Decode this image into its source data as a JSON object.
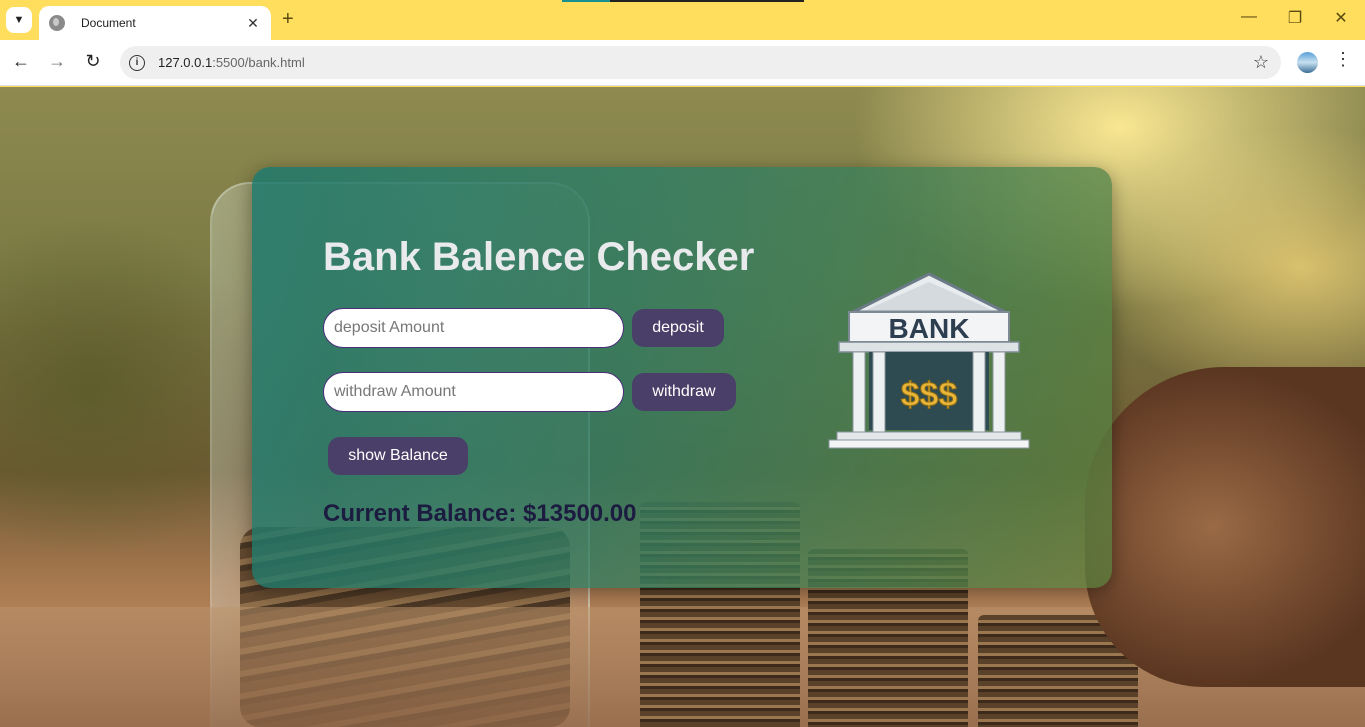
{
  "browser": {
    "tab_title": "Document",
    "url_host": "127.0.0.1",
    "url_path": ":5500/bank.html",
    "tab_list_icon": "chevron-down-icon",
    "new_tab_icon": "plus-icon",
    "close_tab_icon": "close-icon"
  },
  "card": {
    "title": "Bank Balence Checker",
    "deposit_placeholder": "deposit Amount",
    "deposit_button": "deposit",
    "withdraw_placeholder": "withdraw Amount",
    "withdraw_button": "withdraw",
    "show_button": "show Balance",
    "balance_text": "Current Balance: $13500.00"
  },
  "bank_image": {
    "sign": "BANK",
    "symbols": "$$$"
  },
  "colors": {
    "tabbar": "#ffde5e",
    "button": "#4a3f68",
    "balance_text": "#1c1c40"
  }
}
